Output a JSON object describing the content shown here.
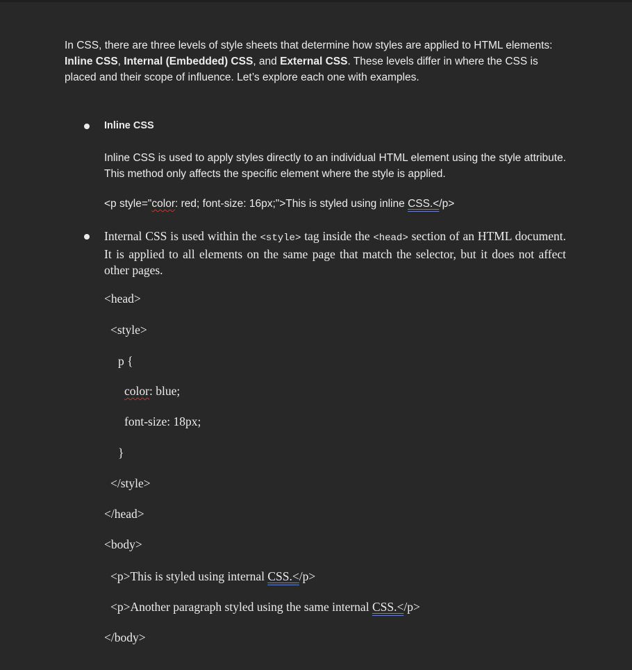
{
  "intro": {
    "p1": "In CSS, there are three levels of style sheets that determine how styles are applied to HTML elements: ",
    "b1": "Inline CSS",
    "s1": ", ",
    "b2": "Internal (Embedded) CSS",
    "s2": ", and ",
    "b3": "External CSS",
    "p2": ". These levels differ in where the CSS is placed and their scope of influence. Let’s explore each one with examples."
  },
  "inline": {
    "heading": "Inline CSS",
    "description": "Inline CSS is used to apply styles directly to an individual HTML element using the style attribute. This method only affects the specific element where the style is applied.",
    "code_a": "<p style=\"",
    "code_b": "color",
    "code_c": ": red; font-size: 16px;\">This is styled using inline ",
    "code_d": "CSS.<",
    "code_e": "/p>"
  },
  "internal": {
    "d1": "Internal CSS is used within the ",
    "d2": "<style>",
    "d3": " tag inside the ",
    "d4": "<head>",
    "d5": " section of an HTML document. It is applied to all elements on the same page that match the selector, but it does not affect other pages.",
    "head_open": "<head>",
    "style_open": "<style>",
    "selector": "p {",
    "color_prop": "color",
    "color_val": ": blue;",
    "font_size": "font-size: 18px;",
    "brace_close": "}",
    "style_close": "</style>",
    "head_close": "</head>",
    "body_open": "<body>",
    "p1_a": "<p>This is styled using internal ",
    "p1_b": "CSS.<",
    "p1_c": "/p>",
    "p2_a": "<p>Another paragraph styled using the same internal ",
    "p2_b": "CSS.<",
    "p2_c": "/p>",
    "body_close": "</body>"
  },
  "colors": {
    "background": "#282828",
    "text": "#ececec",
    "spell_squiggle": "#c0392b",
    "grammar_double_underline": "#6b7fd6"
  }
}
